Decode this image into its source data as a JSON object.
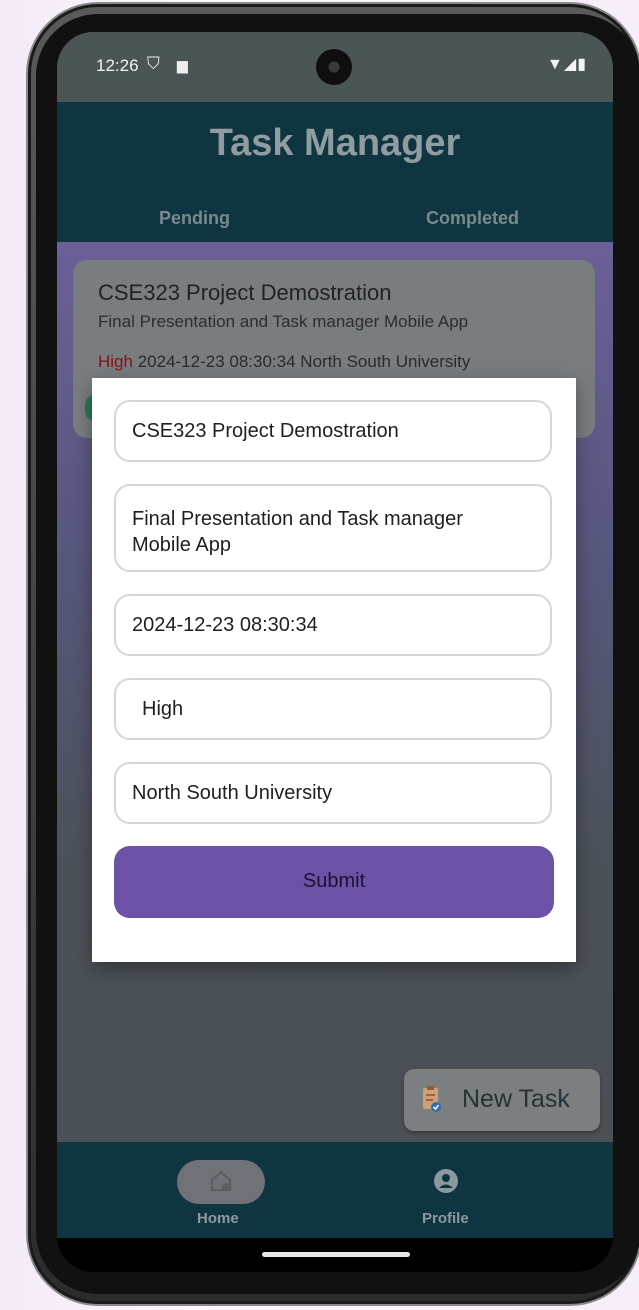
{
  "status_bar": {
    "time": "12:26"
  },
  "app": {
    "title": "Task Manager",
    "tabs": [
      "Pending",
      "Completed"
    ]
  },
  "task_card": {
    "title": "CSE323 Project Demostration",
    "description": "Final Presentation and Task manager Mobile App",
    "priority": "High",
    "datetime": "2024-12-23 08:30:34",
    "location": "North South University"
  },
  "dialog": {
    "title_value": "CSE323 Project Demostration",
    "description_value": "Final Presentation and Task manager Mobile App",
    "datetime_value": "2024-12-23 08:30:34",
    "priority_value": "High",
    "location_value": "North South University",
    "submit_label": "Submit"
  },
  "fab": {
    "label": "New Task"
  },
  "bottom_nav": {
    "home_label": "Home",
    "profile_label": "Profile"
  },
  "colors": {
    "app_bar": "#0f3540",
    "submit_button": "#6c52a6",
    "priority_high": "#8a1010"
  }
}
